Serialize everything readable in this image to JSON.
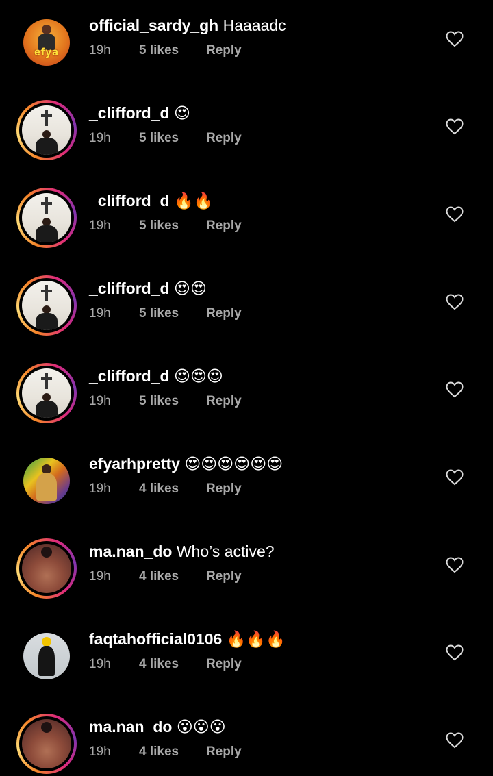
{
  "comments": [
    {
      "username": "official_sardy_gh",
      "text": "Haaaadc",
      "time": "19h",
      "likes": "5 likes",
      "reply": "Reply",
      "avatar": "orange",
      "avatar_text": "efya",
      "story_ring": false
    },
    {
      "username": "_clifford_d",
      "text": "😍",
      "time": "19h",
      "likes": "5 likes",
      "reply": "Reply",
      "avatar": "room",
      "story_ring": true
    },
    {
      "username": "_clifford_d",
      "text": "🔥🔥",
      "time": "19h",
      "likes": "5 likes",
      "reply": "Reply",
      "avatar": "room",
      "story_ring": true
    },
    {
      "username": "_clifford_d",
      "text": "😍😍",
      "time": "19h",
      "likes": "5 likes",
      "reply": "Reply",
      "avatar": "room",
      "story_ring": true
    },
    {
      "username": "_clifford_d",
      "text": "😍😍😍",
      "time": "19h",
      "likes": "5 likes",
      "reply": "Reply",
      "avatar": "room",
      "story_ring": true
    },
    {
      "username": "efyarhpretty",
      "text": "😍😍😍😍😍😍",
      "time": "19h",
      "likes": "4 likes",
      "reply": "Reply",
      "avatar": "colorful",
      "story_ring": false
    },
    {
      "username": "ma.nan_do",
      "text": "Who’s active?",
      "time": "19h",
      "likes": "4 likes",
      "reply": "Reply",
      "avatar": "pink",
      "story_ring": true
    },
    {
      "username": "faqtahofficial0106",
      "text": "🔥🔥🔥",
      "time": "19h",
      "likes": "4 likes",
      "reply": "Reply",
      "avatar": "grey",
      "story_ring": false
    },
    {
      "username": "ma.nan_do",
      "text": "😮😮😮",
      "time": "19h",
      "likes": "4 likes",
      "reply": "Reply",
      "avatar": "pink",
      "story_ring": true
    }
  ],
  "icons": {
    "like": "heart-outline-icon"
  },
  "colors": {
    "background": "#000000",
    "text": "#ffffff",
    "secondary": "#a8a8a8"
  }
}
